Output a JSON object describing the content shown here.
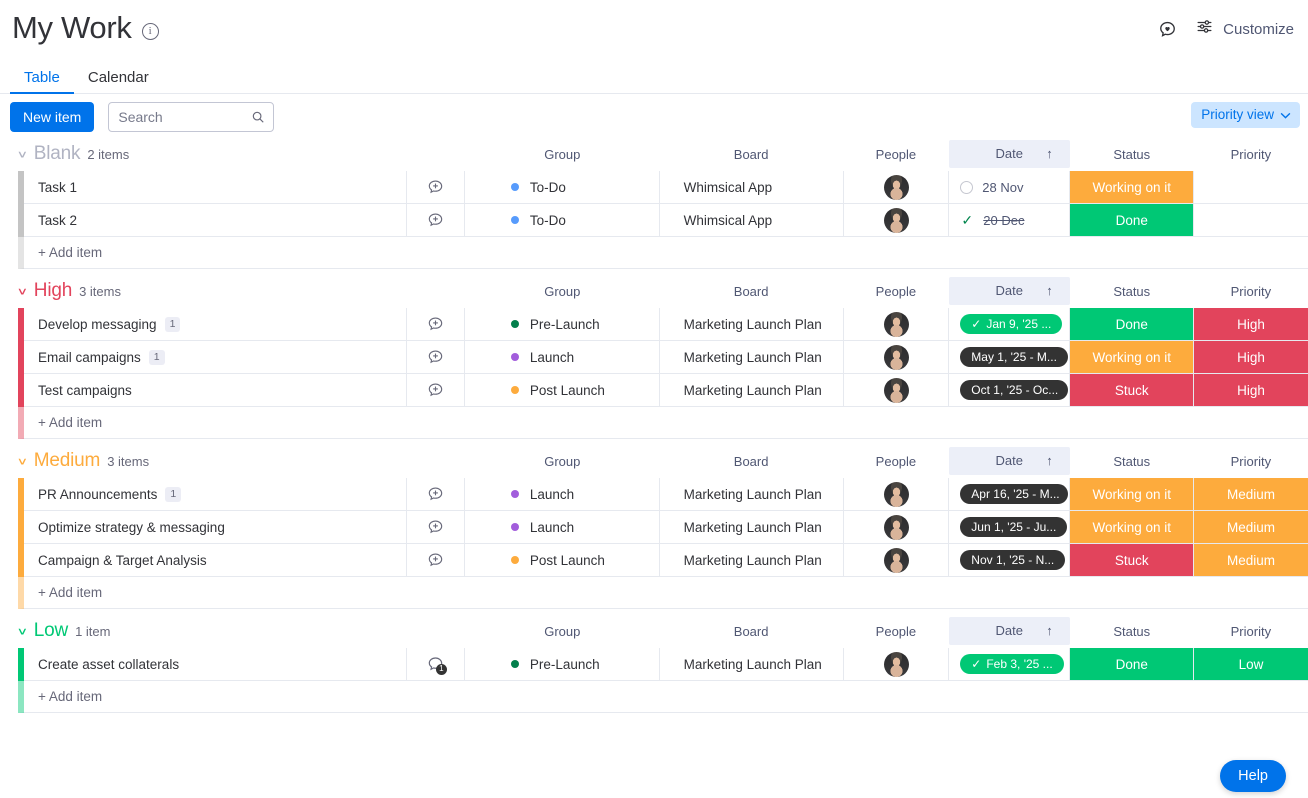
{
  "header": {
    "title": "My Work",
    "info_icon": "info-icon",
    "inbox_icon": "chat-heart-icon",
    "customize_icon": "sliders-icon",
    "customize_label": "Customize"
  },
  "tabs": [
    {
      "label": "Table",
      "active": true
    },
    {
      "label": "Calendar",
      "active": false
    }
  ],
  "toolbar": {
    "new_item_label": "New item",
    "search_placeholder": "Search",
    "search_value": "",
    "search_icon": "search-icon",
    "view_label": "Priority view",
    "view_chevron": "chevron-down-icon"
  },
  "columns": {
    "group": "Group",
    "board": "Board",
    "people": "People",
    "date": "Date",
    "date_sort": "↑",
    "status": "Status",
    "priority": "Priority"
  },
  "add_item_label": "+ Add item",
  "colors": {
    "accent_blue": "#0073ea",
    "status_done": "#00c875",
    "status_working": "#fdab3d",
    "status_stuck": "#e2445c",
    "priority_high": "#e2445c",
    "priority_medium": "#fdab3d",
    "priority_low": "#00c875",
    "group_blank": "#c4c4c4",
    "dot_prelaunch": "#037f4c",
    "dot_launch": "#a25ddc",
    "dot_postlaunch": "#fdab3d",
    "dot_todo": "#579bfc",
    "date_pill_dark": "#333333",
    "view_pill_bg": "#cce5ff"
  },
  "groups": [
    {
      "name": "Blank",
      "name_color": "#b0b3c2",
      "accent_class": "blank",
      "count_label": "2 items",
      "items": [
        {
          "name": "Task 1",
          "sub_count": "",
          "comment_count": "",
          "group": "To-Do",
          "group_dot": "#579bfc",
          "board": "Whimsical App",
          "person": "avatar",
          "date_style": "plain",
          "date_text": "28 Nov",
          "date_done": false,
          "status": "Working on it",
          "status_color": "#fdab3d",
          "priority": "",
          "priority_color": ""
        },
        {
          "name": "Task 2",
          "sub_count": "",
          "comment_count": "",
          "group": "To-Do",
          "group_dot": "#579bfc",
          "board": "Whimsical App",
          "person": "avatar",
          "date_style": "plain",
          "date_text": "20 Dec",
          "date_done": true,
          "status": "Done",
          "status_color": "#00c875",
          "priority": "",
          "priority_color": ""
        }
      ]
    },
    {
      "name": "High",
      "name_color": "#e2445c",
      "accent_class": "high",
      "count_label": "3 items",
      "items": [
        {
          "name": "Develop messaging",
          "sub_count": "1",
          "comment_count": "",
          "group": "Pre-Launch",
          "group_dot": "#037f4c",
          "board": "Marketing Launch Plan",
          "person": "avatar",
          "date_style": "pill-green",
          "date_text": "Jan 9, '25 ...",
          "date_done": true,
          "status": "Done",
          "status_color": "#00c875",
          "priority": "High",
          "priority_color": "#e2445c"
        },
        {
          "name": "Email campaigns",
          "sub_count": "1",
          "comment_count": "",
          "group": "Launch",
          "group_dot": "#a25ddc",
          "board": "Marketing Launch Plan",
          "person": "avatar",
          "date_style": "pill-dark",
          "date_text": "May 1, '25 - M...",
          "date_done": false,
          "status": "Working on it",
          "status_color": "#fdab3d",
          "priority": "High",
          "priority_color": "#e2445c"
        },
        {
          "name": "Test campaigns",
          "sub_count": "",
          "comment_count": "",
          "group": "Post Launch",
          "group_dot": "#fdab3d",
          "board": "Marketing Launch Plan",
          "person": "avatar",
          "date_style": "pill-dark",
          "date_text": "Oct 1, '25 - Oc...",
          "date_done": false,
          "status": "Stuck",
          "status_color": "#e2445c",
          "priority": "High",
          "priority_color": "#e2445c"
        }
      ]
    },
    {
      "name": "Medium",
      "name_color": "#fdab3d",
      "accent_class": "medium",
      "count_label": "3 items",
      "items": [
        {
          "name": "PR Announcements",
          "sub_count": "1",
          "comment_count": "",
          "group": "Launch",
          "group_dot": "#a25ddc",
          "board": "Marketing Launch Plan",
          "person": "avatar",
          "date_style": "pill-dark",
          "date_text": "Apr 16, '25 - M...",
          "date_done": false,
          "status": "Working on it",
          "status_color": "#fdab3d",
          "priority": "Medium",
          "priority_color": "#fdab3d"
        },
        {
          "name": "Optimize strategy & messaging",
          "sub_count": "",
          "comment_count": "",
          "group": "Launch",
          "group_dot": "#a25ddc",
          "board": "Marketing Launch Plan",
          "person": "avatar",
          "date_style": "pill-dark",
          "date_text": "Jun 1, '25 - Ju...",
          "date_done": false,
          "status": "Working on it",
          "status_color": "#fdab3d",
          "priority": "Medium",
          "priority_color": "#fdab3d"
        },
        {
          "name": "Campaign & Target Analysis",
          "sub_count": "",
          "comment_count": "",
          "group": "Post Launch",
          "group_dot": "#fdab3d",
          "board": "Marketing Launch Plan",
          "person": "avatar",
          "date_style": "pill-dark",
          "date_text": "Nov 1, '25 - N...",
          "date_done": false,
          "status": "Stuck",
          "status_color": "#e2445c",
          "priority": "Medium",
          "priority_color": "#fdab3d"
        }
      ]
    },
    {
      "name": "Low",
      "name_color": "#00c875",
      "accent_class": "low",
      "count_label": "1 item",
      "items": [
        {
          "name": "Create asset collaterals",
          "sub_count": "",
          "comment_count": "1",
          "group": "Pre-Launch",
          "group_dot": "#037f4c",
          "board": "Marketing Launch Plan",
          "person": "avatar",
          "date_style": "pill-green",
          "date_text": "Feb 3, '25 ...",
          "date_done": true,
          "status": "Done",
          "status_color": "#00c875",
          "priority": "Low",
          "priority_color": "#00c875"
        }
      ]
    }
  ],
  "help": {
    "label": "Help"
  }
}
